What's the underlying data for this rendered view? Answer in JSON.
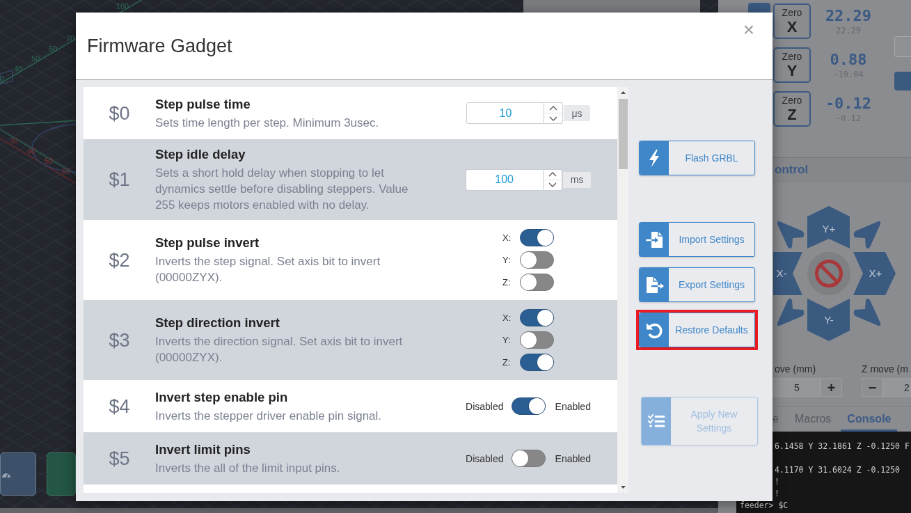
{
  "toolpath_view": {
    "green_labels": [
      "0",
      "40",
      "50",
      "60",
      "70",
      "100"
    ],
    "red_labels": [
      "30",
      "40",
      "50",
      "60"
    ]
  },
  "machine_panel": {
    "dro": [
      {
        "button_label": "Zero",
        "axis": "X",
        "work_value": "22.29",
        "machine_value": "22.29"
      },
      {
        "button_label": "Zero",
        "axis": "Y",
        "work_value": "0.88",
        "machine_value": "-19.04"
      },
      {
        "button_label": "Zero",
        "axis": "Z",
        "work_value": "-0.12",
        "machine_value": "-0.12"
      }
    ],
    "section_title": "ontrol",
    "jog_buttons": [
      {
        "label": "Y+"
      },
      {
        "label": "X-"
      },
      {
        "label": "X+"
      },
      {
        "label": "Y-"
      }
    ],
    "xy_step": {
      "label": "ove (mm)",
      "value": "5",
      "increase": "+"
    },
    "z_step": {
      "label": "Z move (m",
      "decrease": "−",
      "value": "2"
    },
    "tabs": [
      {
        "label": "e",
        "selected": false
      },
      {
        "label": "Macros",
        "selected": false
      },
      {
        "label": "Console",
        "selected": true
      }
    ],
    "console": {
      "lines": [
        "6.1458 Y 32.1861 Z -0.1250 F",
        "4.1170 Y 31.6024 Z -0.1250",
        "!",
        "!"
      ],
      "prompt_line": "feeder> $C"
    }
  },
  "dialog": {
    "title": "Firmware Gadget",
    "close": "×",
    "settings": [
      {
        "code": "$0",
        "title": "Step pulse time",
        "description": "Sets time length per step. Minimum 3usec.",
        "kind": "number",
        "value": "10",
        "unit": "μs"
      },
      {
        "code": "$1",
        "title": "Step idle delay",
        "description": "Sets a short hold delay when stopping to let dynamics settle before disabling steppers. Value 255 keeps motors enabled with no delay.",
        "kind": "number",
        "value": "100",
        "unit": "ms"
      },
      {
        "code": "$2",
        "title": "Step pulse invert",
        "description": "Inverts the step signal. Set axis bit to invert (00000ZYX).",
        "kind": "axes",
        "axes": [
          {
            "label": "X:",
            "on": true
          },
          {
            "label": "Y:",
            "on": false
          },
          {
            "label": "Z:",
            "on": false
          }
        ]
      },
      {
        "code": "$3",
        "title": "Step direction invert",
        "description": "Inverts the direction signal. Set axis bit to invert (00000ZYX).",
        "kind": "axes",
        "axes": [
          {
            "label": "X:",
            "on": true
          },
          {
            "label": "Y:",
            "on": false
          },
          {
            "label": "Z:",
            "on": true
          }
        ]
      },
      {
        "code": "$4",
        "title": "Invert step enable pin",
        "description": "Inverts the stepper driver enable pin signal.",
        "kind": "switch",
        "off_label": "Disabled",
        "on_label": "Enabled",
        "on": true
      },
      {
        "code": "$5",
        "title": "Invert limit pins",
        "description": "Inverts the all of the limit input pins.",
        "kind": "switch",
        "off_label": "Disabled",
        "on_label": "Enabled",
        "on": false
      }
    ],
    "actions": [
      {
        "kind": "flash",
        "label": "Flash GRBL",
        "disabled": false,
        "highlighted": false
      },
      {
        "kind": "import",
        "label": "Import Settings",
        "disabled": false,
        "highlighted": false
      },
      {
        "kind": "export",
        "label": "Export Settings",
        "disabled": false,
        "highlighted": false
      },
      {
        "kind": "restore",
        "label": "Restore Defaults",
        "disabled": false,
        "highlighted": true
      },
      {
        "kind": "apply",
        "label": "Apply New Settings",
        "disabled": true,
        "highlighted": false
      }
    ]
  }
}
